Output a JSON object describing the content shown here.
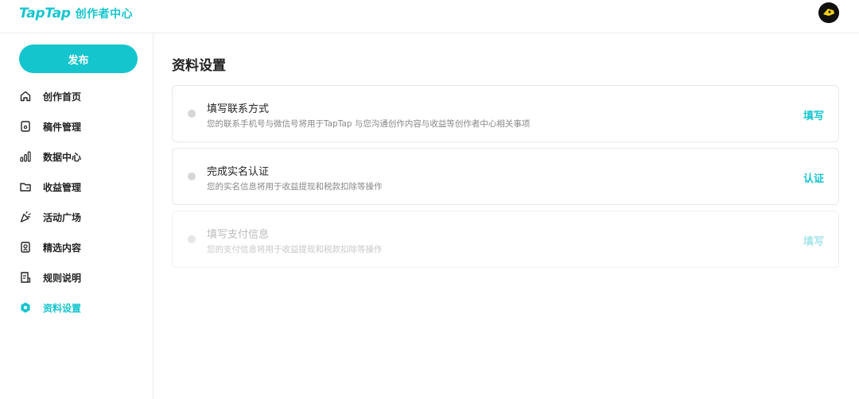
{
  "header": {
    "brand": "TapTap",
    "subtitle": "创作者中心",
    "avatar_icon": "avatar-icon"
  },
  "sidebar": {
    "publish_label": "发布",
    "items": [
      {
        "label": "创作首页",
        "icon": "home-icon",
        "active": false
      },
      {
        "label": "稿件管理",
        "icon": "document-icon",
        "active": false
      },
      {
        "label": "数据中心",
        "icon": "bar-chart-icon",
        "active": false
      },
      {
        "label": "收益管理",
        "icon": "folder-icon",
        "active": false
      },
      {
        "label": "活动广场",
        "icon": "party-icon",
        "active": false
      },
      {
        "label": "精选内容",
        "icon": "featured-icon",
        "active": false
      },
      {
        "label": "规则说明",
        "icon": "rules-icon",
        "active": false
      },
      {
        "label": "资料设置",
        "icon": "settings-icon",
        "active": true
      }
    ]
  },
  "main": {
    "title": "资料设置",
    "cards": [
      {
        "title": "填写联系方式",
        "description": "您的联系手机号与微信号将用于TapTap 与您沟通创作内容与收益等创作者中心相关事项",
        "action": "填写",
        "disabled": false
      },
      {
        "title": "完成实名认证",
        "description": "您的实名信息将用于收益提现和税款扣除等操作",
        "action": "认证",
        "disabled": false
      },
      {
        "title": "填写支付信息",
        "description": "您的支付信息将用于收益提现和税款扣除等操作",
        "action": "填写",
        "disabled": true
      }
    ]
  },
  "colors": {
    "accent": "#15c5ce",
    "text": "#222222",
    "muted": "#888888"
  }
}
